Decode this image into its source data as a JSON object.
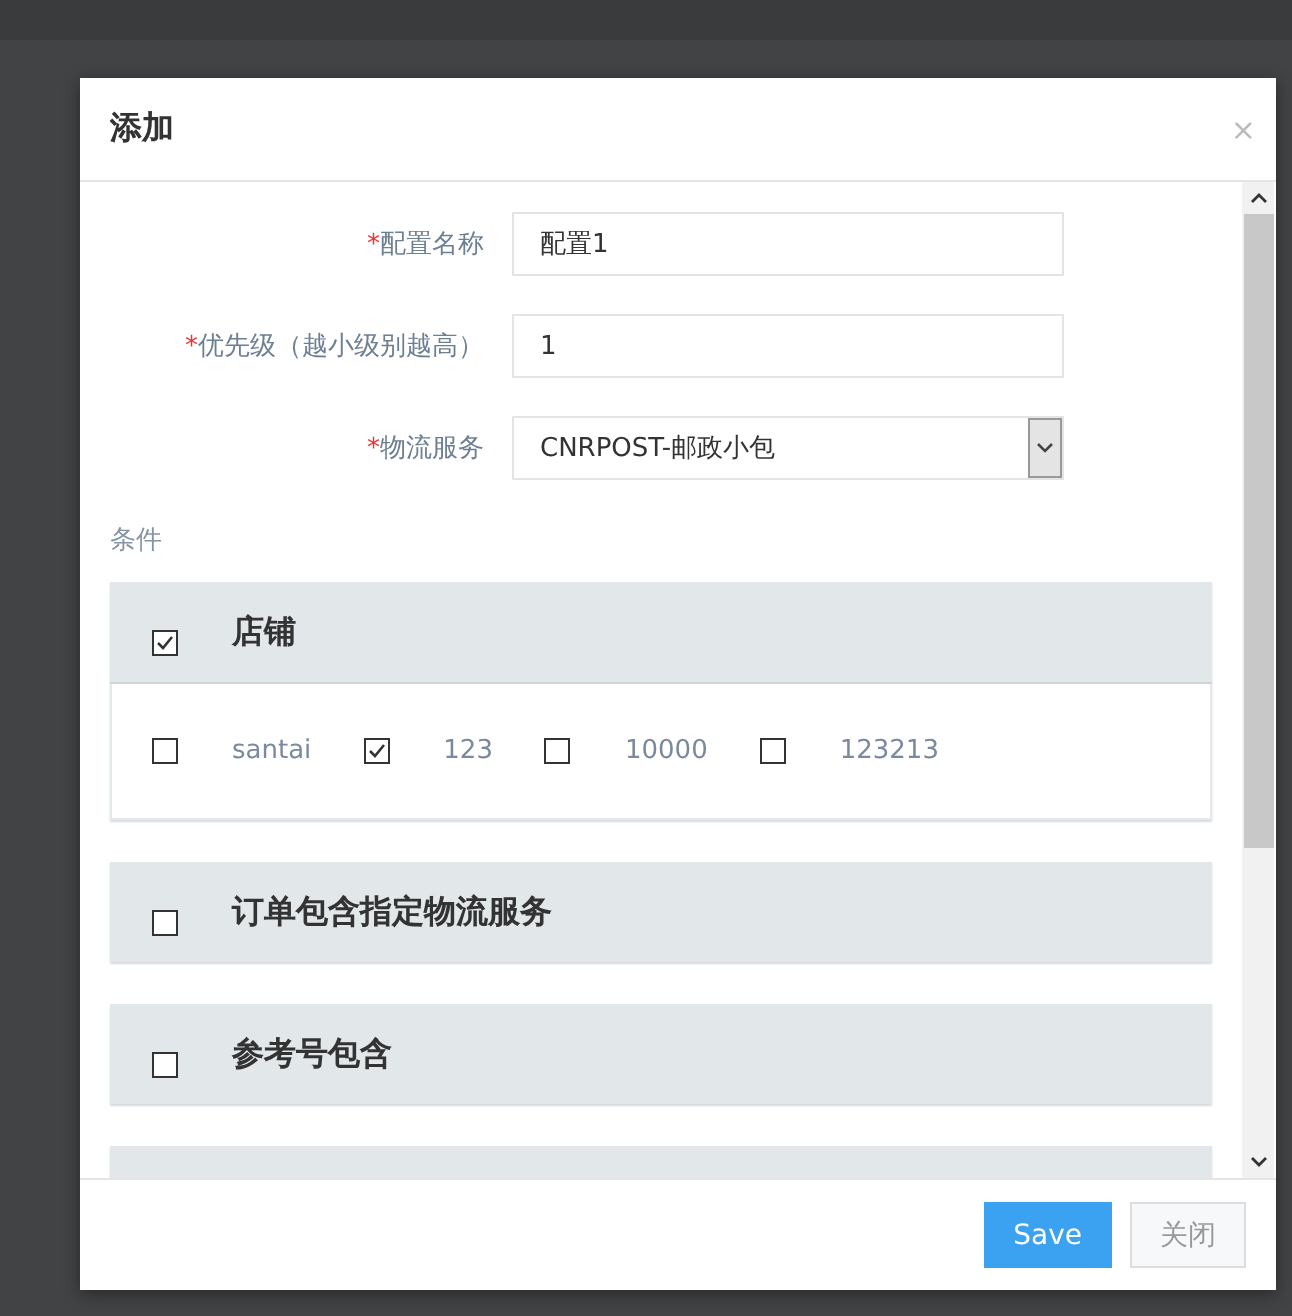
{
  "dialog": {
    "title": "添加",
    "close": "×",
    "fields": [
      {
        "kind": "text",
        "required_mark": "*",
        "label": "配置名称",
        "value": "配置1"
      },
      {
        "kind": "text",
        "required_mark": "*",
        "label": "优先级（越小级别越高）",
        "value": "1"
      },
      {
        "kind": "select",
        "required_mark": "*",
        "label": "物流服务",
        "value": "CNRPOST-邮政小包"
      }
    ],
    "conditions_label": "条件",
    "conditions": [
      {
        "kind": "section",
        "title": "店铺",
        "checked": true,
        "expanded": true,
        "options": [
          {
            "label": "santai",
            "checked": false
          },
          {
            "label": "123",
            "checked": true
          },
          {
            "label": "10000",
            "checked": false
          },
          {
            "label": "123213",
            "checked": false
          }
        ]
      },
      {
        "kind": "section",
        "title": "订单包含指定物流服务",
        "checked": false,
        "expanded": false
      },
      {
        "kind": "section",
        "title": "参考号包含",
        "checked": false,
        "expanded": false
      },
      {
        "kind": "cut-off"
      }
    ],
    "buttons": [
      {
        "kind": "primary",
        "label": "Save"
      },
      {
        "kind": "default",
        "label": "关闭"
      }
    ]
  }
}
